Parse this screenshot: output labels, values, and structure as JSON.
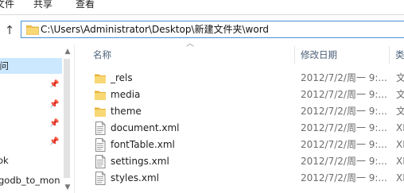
{
  "ribbon": {
    "tabs": [
      {
        "label": "文件"
      },
      {
        "label": "共享"
      },
      {
        "label": "查看"
      }
    ]
  },
  "address": {
    "path": "C:\\Users\\Administrator\\Desktop\\新建文件夹\\word"
  },
  "nav": {
    "items": [
      {
        "label": "访问",
        "selected": true
      },
      {
        "label": "",
        "pinned": true
      },
      {
        "label": "",
        "pinned": true
      },
      {
        "label": "",
        "pinned": true
      },
      {
        "label": "",
        "pinned": true
      },
      {
        "label": "ok"
      },
      {
        "label": "godb_to_mon"
      }
    ]
  },
  "columns": {
    "name": "名称",
    "date": "修改日期",
    "type": "类"
  },
  "files": [
    {
      "name": "_rels",
      "kind": "folder",
      "date": "2012/7/2/周一 9:...",
      "type": "文"
    },
    {
      "name": "media",
      "kind": "folder",
      "date": "2012/7/2/周一 9:...",
      "type": "文"
    },
    {
      "name": "theme",
      "kind": "folder",
      "date": "2012/7/2/周一 9:...",
      "type": "文"
    },
    {
      "name": "document.xml",
      "kind": "xml",
      "date": "2012/7/2/周一 9:...",
      "type": "XI"
    },
    {
      "name": "fontTable.xml",
      "kind": "xml",
      "date": "2012/7/2/周一 9:...",
      "type": "XI"
    },
    {
      "name": "settings.xml",
      "kind": "xml",
      "date": "2012/7/2/周一 9:...",
      "type": "XI"
    },
    {
      "name": "styles.xml",
      "kind": "xml",
      "date": "2012/7/2/周一 9:...",
      "type": "XI"
    }
  ],
  "colors": {
    "folder": "#f2c14e",
    "selection": "#cce8ff",
    "accent": "#4a90d9"
  }
}
